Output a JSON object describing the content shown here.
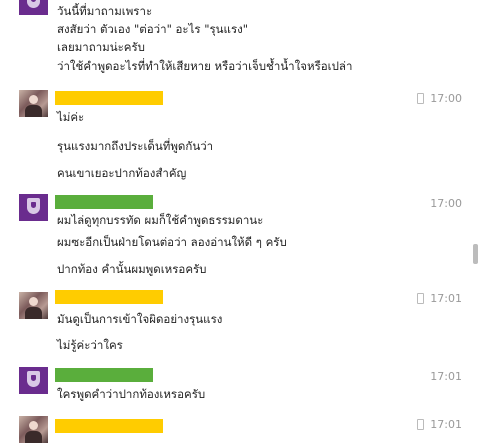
{
  "messages": [
    {
      "avatar": "school-crest-avatar",
      "lines": [
        "วันนี้ที่มาถามเพราะ",
        "สงสัยว่า ตัวเอง \"ต่อว่า\" อะไร \"รุนแรง\"",
        "เลยมาถามน่ะครับ",
        "ว่าใช้คำพูดอะไรที่ทำให้เสียหาย หรือว่าเจ็บช้ำน้ำใจหรือเปล่า"
      ]
    },
    {
      "avatar": "photo-avatar",
      "time": "17:00",
      "time_icon": "phone-icon",
      "lines": [
        "ไม่ค่ะ",
        "รุนแรงมากถึงประเด็นที่พูดกันว่า",
        "คนเขาเยอะปากท้องสำคัญ"
      ]
    },
    {
      "avatar": "school-crest-avatar",
      "time": "17:00",
      "lines": [
        "ผมไล่ดูทุกบรรทัด ผมก็ใช้คำพูดธรรมดานะ",
        "ผมซะอีกเป็นฝ่ายโดนต่อว่า ลองอ่านให้ดี ๆ ครับ",
        "ปากท้อง คำนั้นผมพูดเหรอครับ"
      ]
    },
    {
      "avatar": "photo-avatar",
      "time": "17:01",
      "time_icon": "phone-icon",
      "lines": [
        "มันดูเป็นการเข้าใจผิดอย่างรุนแรง",
        "ไม่รู้ค่ะว่าใคร"
      ]
    },
    {
      "avatar": "school-crest-avatar",
      "time": "17:01",
      "lines": [
        "ใครพูดคำว่าปากท้องเหรอครับ"
      ]
    },
    {
      "avatar": "photo-avatar",
      "time": "17:01",
      "time_icon": "phone-icon",
      "lines": []
    }
  ],
  "colors": {
    "redaction_yellow": "#ffcc00",
    "redaction_green": "#5aae3c",
    "crest_purple": "#6a2c8e",
    "timestamp_gray": "#999999"
  }
}
